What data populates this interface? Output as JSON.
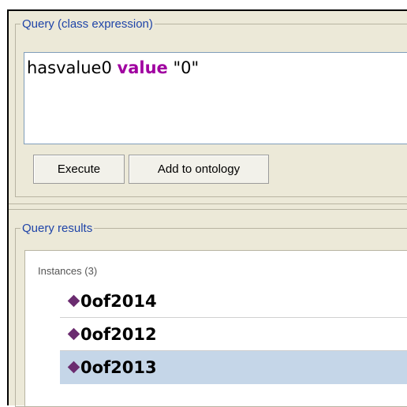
{
  "query_panel": {
    "legend": "Query (class expression)",
    "expression": {
      "property": "hasvalue0",
      "keyword": "value",
      "literal": "\"0\""
    },
    "buttons": {
      "execute": "Execute",
      "add_to_ontology": "Add to ontology"
    }
  },
  "results_panel": {
    "legend": "Query results",
    "section_header": "Instances (3)",
    "items": [
      {
        "label": "0of2014",
        "selected": false,
        "icon": "individual-diamond-icon"
      },
      {
        "label": "0of2012",
        "selected": false,
        "icon": "individual-diamond-icon"
      },
      {
        "label": "0of2013",
        "selected": true,
        "icon": "individual-diamond-icon"
      }
    ]
  },
  "colors": {
    "legend_text": "#1f44a8",
    "keyword": "#a000a0",
    "individual_icon": "#6b2c70",
    "selection": "#c5d6e8",
    "panel_bg": "#ece9d8"
  }
}
